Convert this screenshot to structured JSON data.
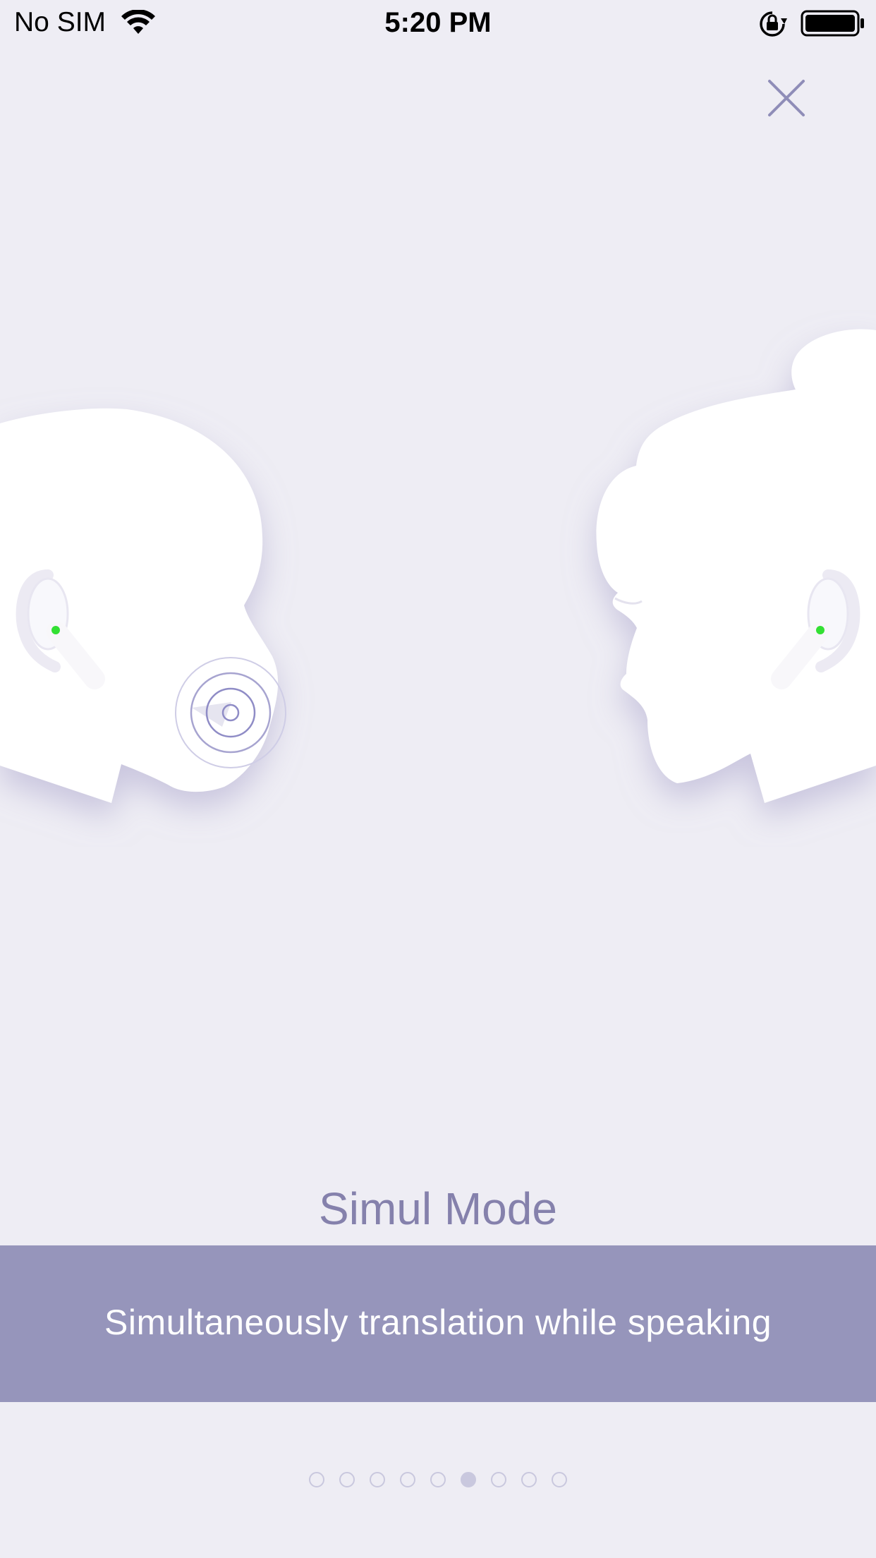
{
  "status_bar": {
    "carrier": "No SIM",
    "time": "5:20 PM",
    "icons": [
      "wifi-icon",
      "orientation-lock-icon",
      "battery-icon"
    ]
  },
  "close_button": {
    "icon": "close-icon"
  },
  "illustration": {
    "description_icons": [
      "man-head-icon",
      "woman-head-icon",
      "earbud-icon",
      "sound-wave-icon"
    ],
    "accent_color": "#33e033"
  },
  "onboarding": {
    "title": "Simul Mode",
    "subtitle": "Simultaneously translation while speaking"
  },
  "pager": {
    "total": 9,
    "active_index": 5
  },
  "colors": {
    "background": "#eeedf4",
    "title": "#8581ac",
    "banner": "#9695bb",
    "dot": "#c9c8de"
  }
}
